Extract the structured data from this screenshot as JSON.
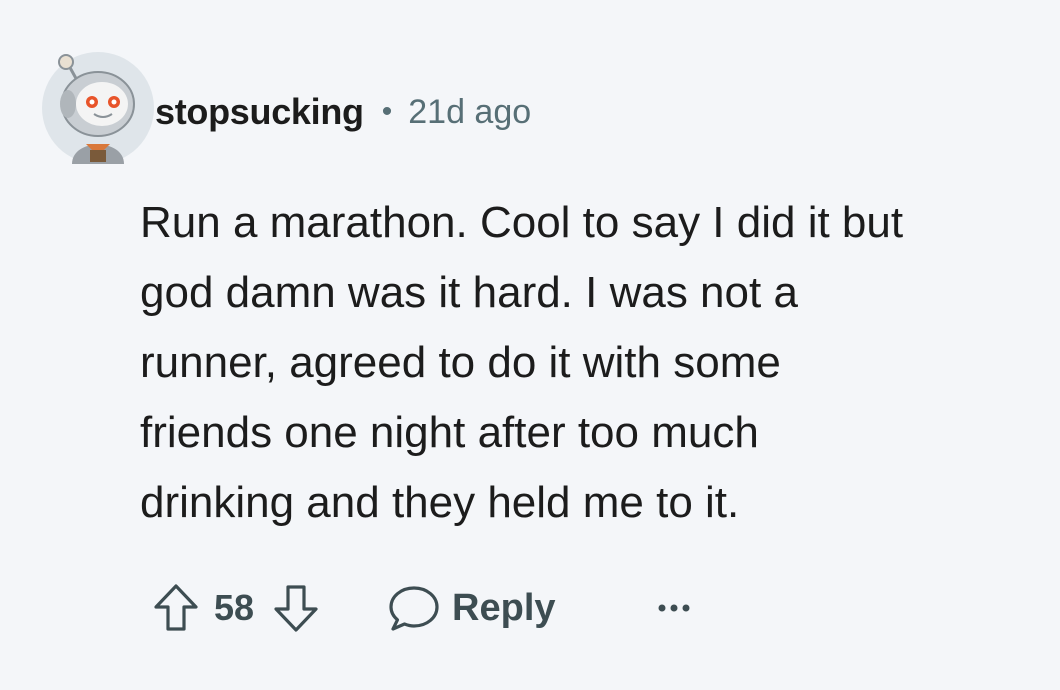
{
  "comment": {
    "username": "stopsucking",
    "separator": "•",
    "timestamp": "21d ago",
    "body_lines": [
      "Run a marathon. Cool to say I did it but",
      "god damn was it hard. I was not a",
      "runner, agreed to do it with some",
      "friends one night after too much",
      "drinking and they held me to it."
    ],
    "score": "58",
    "reply_label": "Reply"
  },
  "icons": {
    "avatar": "snoo-astronaut-avatar",
    "upvote": "arrow-up-outline-icon",
    "downvote": "arrow-down-outline-icon",
    "reply": "speech-bubble-icon",
    "more": "ellipsis-icon"
  },
  "colors": {
    "background": "#f4f6f9",
    "text": "#1c1c1c",
    "meta": "#576f76",
    "action": "#3d4d52"
  }
}
